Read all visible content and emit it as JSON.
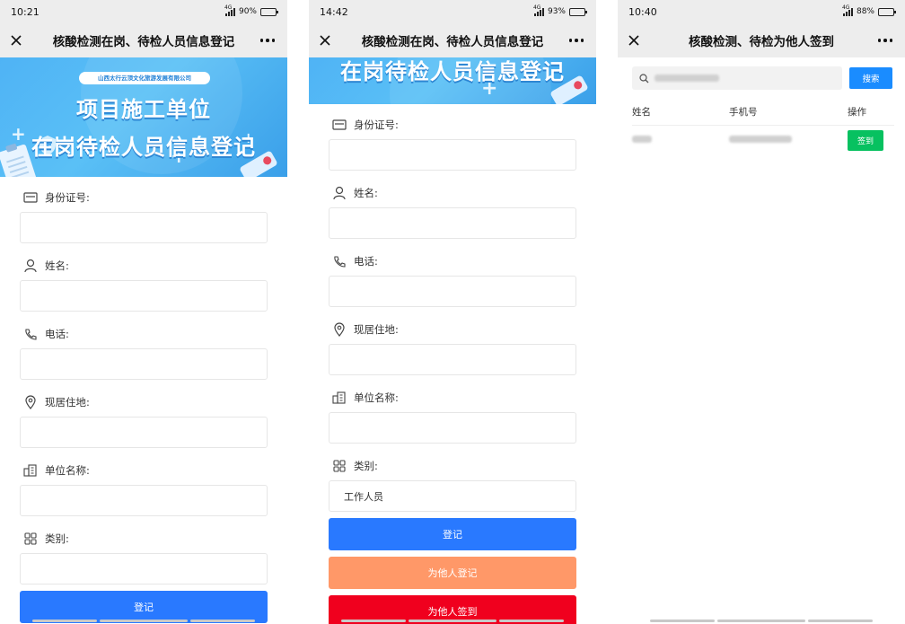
{
  "colors": {
    "nav_bg": "#ededed",
    "primary_blue": "#2979ff",
    "orange": "#ff9868",
    "red": "#f0001e",
    "green": "#07c160",
    "search_blue": "#1a8cff"
  },
  "screens": [
    {
      "status": {
        "time": "10:21",
        "network": "4G",
        "battery_text": "90%",
        "battery_level": 0.9
      },
      "nav": {
        "title": "核酸检测在岗、待检人员信息登记"
      },
      "banner": {
        "company": "山西太行云顶文化旅游发展有限公司",
        "line1": "项目施工单位",
        "line2": "在岗待检人员信息登记"
      },
      "form": {
        "fields": [
          {
            "label": "身份证号:",
            "icon": "id-card-icon",
            "value": ""
          },
          {
            "label": "姓名:",
            "icon": "person-icon",
            "value": ""
          },
          {
            "label": "电话:",
            "icon": "phone-icon",
            "value": ""
          },
          {
            "label": "现居住地:",
            "icon": "location-pin-icon",
            "value": ""
          },
          {
            "label": "单位名称:",
            "icon": "building-icon",
            "value": ""
          },
          {
            "label": "类别:",
            "icon": "grid-icon",
            "value": ""
          }
        ],
        "register_label": "登记"
      }
    },
    {
      "status": {
        "time": "14:42",
        "network": "4G",
        "battery_text": "93%",
        "battery_level": 0.93
      },
      "nav": {
        "title": "核酸检测在岗、待检人员信息登记"
      },
      "banner": {
        "line2": "在岗待检人员信息登记"
      },
      "form": {
        "fields": [
          {
            "label": "身份证号:",
            "icon": "id-card-icon",
            "value": ""
          },
          {
            "label": "姓名:",
            "icon": "person-icon",
            "value": ""
          },
          {
            "label": "电话:",
            "icon": "phone-icon",
            "value": ""
          },
          {
            "label": "现居住地:",
            "icon": "location-pin-icon",
            "value": ""
          },
          {
            "label": "单位名称:",
            "icon": "building-icon",
            "value": ""
          },
          {
            "label": "类别:",
            "icon": "grid-icon",
            "value": "工作人员"
          }
        ],
        "register_label": "登记",
        "register_for_others_label": "为他人登记",
        "checkin_for_others_label": "为他人签到"
      }
    },
    {
      "status": {
        "time": "10:40",
        "network": "4G",
        "battery_text": "88%",
        "battery_level": 0.88
      },
      "nav": {
        "title": "核酸检测、待检为他人签到"
      },
      "search": {
        "value": "",
        "button_label": "搜索"
      },
      "table": {
        "headers": [
          "姓名",
          "手机号",
          "操作"
        ],
        "rows": [
          {
            "name": "",
            "phone": "",
            "action": "签到"
          }
        ]
      }
    }
  ]
}
